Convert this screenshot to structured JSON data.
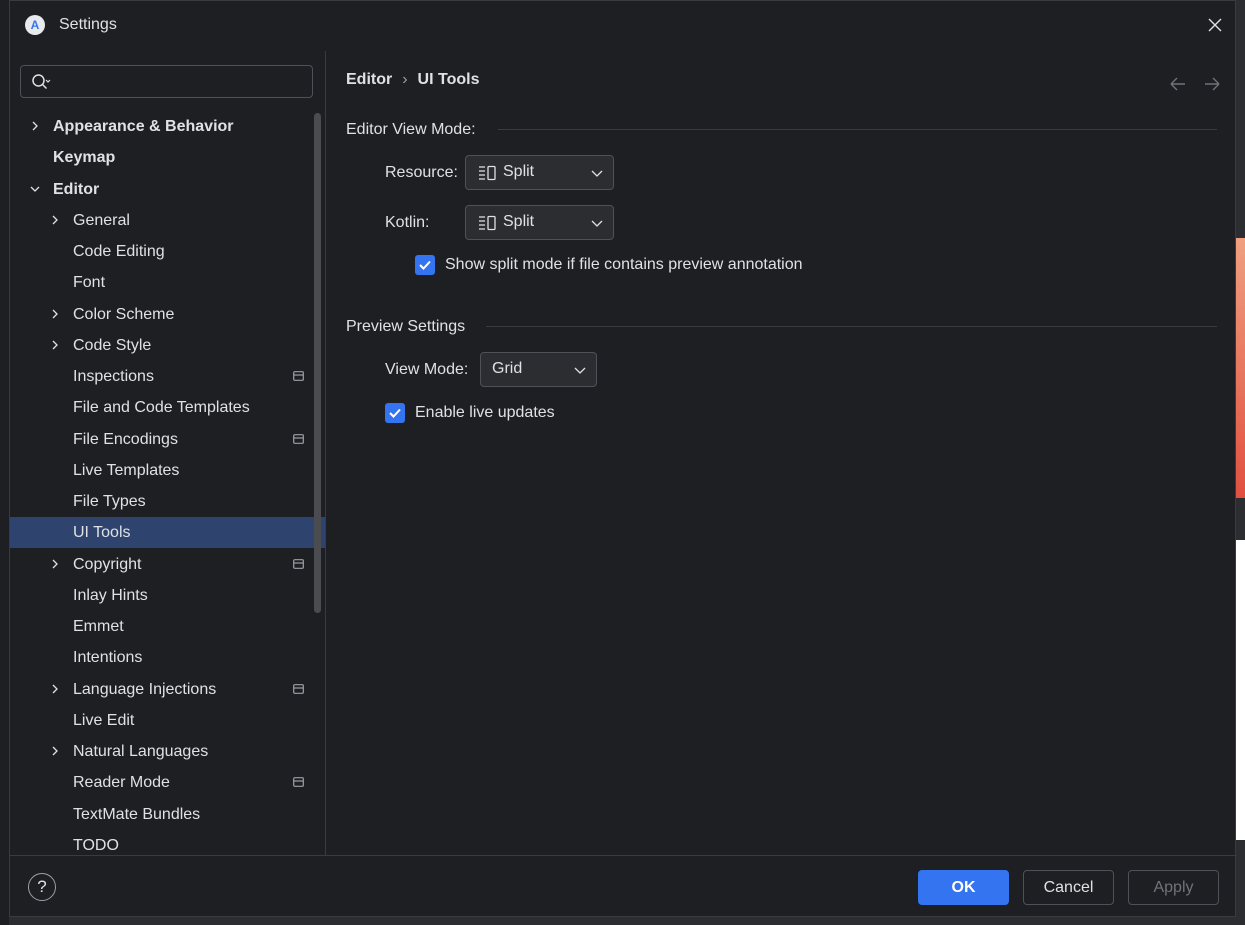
{
  "window": {
    "title": "Settings"
  },
  "search": {
    "value": "",
    "placeholder": ""
  },
  "sidebar": {
    "items": [
      {
        "label": "Appearance & Behavior",
        "level": 0,
        "expandable": true,
        "expanded": false,
        "bold": true,
        "project_icon": false
      },
      {
        "label": "Keymap",
        "level": 0,
        "expandable": false,
        "bold": true,
        "project_icon": false
      },
      {
        "label": "Editor",
        "level": 0,
        "expandable": true,
        "expanded": true,
        "bold": true,
        "project_icon": false
      },
      {
        "label": "General",
        "level": 1,
        "expandable": true,
        "expanded": false,
        "project_icon": false
      },
      {
        "label": "Code Editing",
        "level": 1,
        "expandable": false,
        "project_icon": false
      },
      {
        "label": "Font",
        "level": 1,
        "expandable": false,
        "project_icon": false
      },
      {
        "label": "Color Scheme",
        "level": 1,
        "expandable": true,
        "expanded": false,
        "project_icon": false
      },
      {
        "label": "Code Style",
        "level": 1,
        "expandable": true,
        "expanded": false,
        "project_icon": false
      },
      {
        "label": "Inspections",
        "level": 1,
        "expandable": false,
        "project_icon": true
      },
      {
        "label": "File and Code Templates",
        "level": 1,
        "expandable": false,
        "project_icon": false
      },
      {
        "label": "File Encodings",
        "level": 1,
        "expandable": false,
        "project_icon": true
      },
      {
        "label": "Live Templates",
        "level": 1,
        "expandable": false,
        "project_icon": false
      },
      {
        "label": "File Types",
        "level": 1,
        "expandable": false,
        "project_icon": false
      },
      {
        "label": "UI Tools",
        "level": 1,
        "expandable": false,
        "selected": true,
        "project_icon": false
      },
      {
        "label": "Copyright",
        "level": 1,
        "expandable": true,
        "expanded": false,
        "project_icon": true
      },
      {
        "label": "Inlay Hints",
        "level": 1,
        "expandable": false,
        "project_icon": false
      },
      {
        "label": "Emmet",
        "level": 1,
        "expandable": false,
        "project_icon": false
      },
      {
        "label": "Intentions",
        "level": 1,
        "expandable": false,
        "project_icon": false
      },
      {
        "label": "Language Injections",
        "level": 1,
        "expandable": true,
        "expanded": false,
        "project_icon": true
      },
      {
        "label": "Live Edit",
        "level": 1,
        "expandable": false,
        "project_icon": false
      },
      {
        "label": "Natural Languages",
        "level": 1,
        "expandable": true,
        "expanded": false,
        "project_icon": false
      },
      {
        "label": "Reader Mode",
        "level": 1,
        "expandable": false,
        "project_icon": true
      },
      {
        "label": "TextMate Bundles",
        "level": 1,
        "expandable": false,
        "project_icon": false
      },
      {
        "label": "TODO",
        "level": 1,
        "expandable": false,
        "project_icon": false
      }
    ]
  },
  "breadcrumb": {
    "parent": "Editor",
    "separator": "›",
    "current": "UI Tools"
  },
  "editor_view_mode": {
    "title": "Editor View Mode:",
    "resource_label": "Resource:",
    "resource_value": "Split",
    "kotlin_label": "Kotlin:",
    "kotlin_value": "Split",
    "split_checkbox_label": "Show split mode if file contains preview annotation",
    "split_checkbox_checked": true
  },
  "preview_settings": {
    "title": "Preview Settings",
    "view_mode_label": "View Mode:",
    "view_mode_value": "Grid",
    "live_updates_label": "Enable live updates",
    "live_updates_checked": true
  },
  "footer": {
    "help_label": "?",
    "ok_label": "OK",
    "cancel_label": "Cancel",
    "apply_label": "Apply"
  },
  "colors": {
    "accent": "#3574f0",
    "selection": "#2e436e",
    "background": "#1e1f22",
    "text": "#dfe1e5"
  }
}
